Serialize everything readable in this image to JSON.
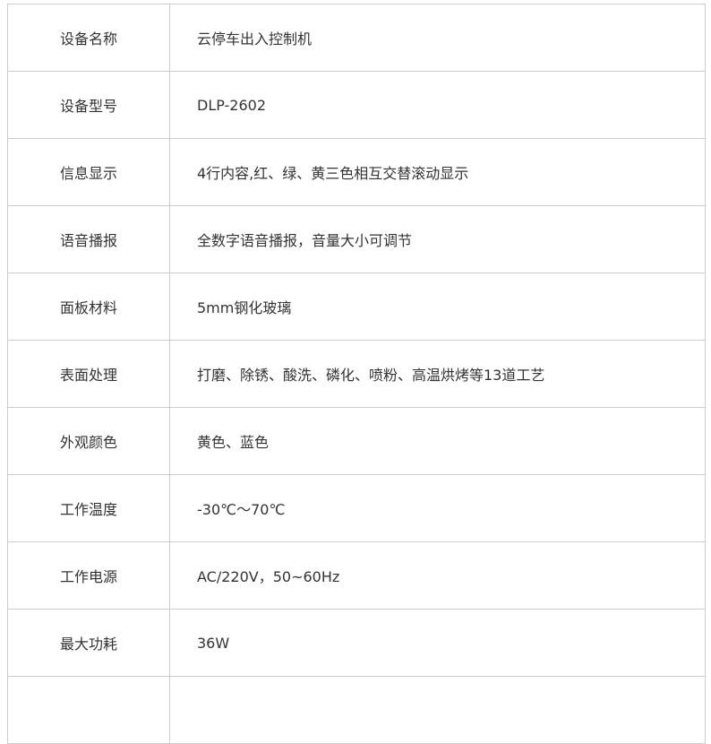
{
  "specs": {
    "rows": [
      {
        "label": "设备名称",
        "value": "云停车出入控制机"
      },
      {
        "label": "设备型号",
        "value": "DLP-2602"
      },
      {
        "label": "信息显示",
        "value": "4行内容,红、绿、黄三色相互交替滚动显示"
      },
      {
        "label": "语音播报",
        "value": "全数字语音播报，音量大小可调节"
      },
      {
        "label": "面板材料",
        "value": "5mm钢化玻璃"
      },
      {
        "label": "表面处理",
        "value": "打磨、除锈、酸洗、磷化、喷粉、高温烘烤等13道工艺"
      },
      {
        "label": "外观颜色",
        "value": "黄色、蓝色"
      },
      {
        "label": "工作温度",
        "value": "-30℃～70℃"
      },
      {
        "label": "工作电源",
        "value": "AC/220V，50~60Hz"
      },
      {
        "label": "最大功耗",
        "value": "36W"
      },
      {
        "label": "",
        "value": ""
      }
    ]
  }
}
